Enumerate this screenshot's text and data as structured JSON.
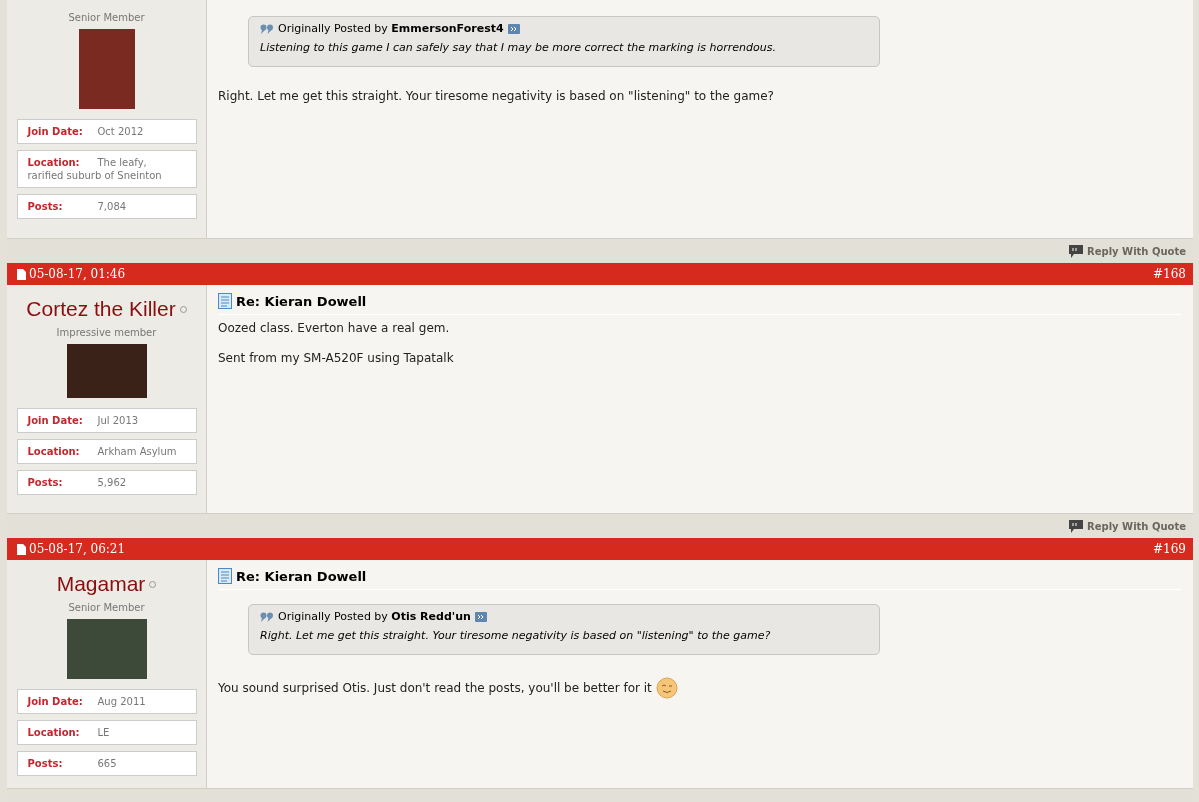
{
  "posts": [
    {
      "rank": "Senior Member",
      "info": [
        {
          "label": "Join Date:",
          "value": "Oct 2012"
        },
        {
          "label": "Location:",
          "value": "The leafy, rarified suburb of Sneinton"
        },
        {
          "label": "Posts:",
          "value": "7,084"
        }
      ],
      "quote": {
        "prefix": "Originally Posted by",
        "author": "EmmersonForest4",
        "text": "Listening to this game I can safely say that I may be more correct the marking is horrendous."
      },
      "message": [
        {
          "text": "Right. Let me get this straight. Your tiresome negativity is based on \"listening\" to the game?",
          "smiley": false
        }
      ],
      "reply": "Reply With Quote"
    },
    {
      "date": "05-08-17, 01:46",
      "number": "#168",
      "user": {
        "name": "Cortez the Killer",
        "online": false
      },
      "rank": "Impressive member",
      "info": [
        {
          "label": "Join Date:",
          "value": "Jul 2013"
        },
        {
          "label": "Location:",
          "value": "Arkham Asylum"
        },
        {
          "label": "Posts:",
          "value": "5,962"
        }
      ],
      "title": "Re: Kieran Dowell",
      "message": [
        {
          "text": "Oozed class. Everton have a real gem.",
          "smiley": false
        },
        {
          "text": "Sent from my SM-A520F using Tapatalk",
          "smiley": false
        }
      ],
      "reply": "Reply With Quote"
    },
    {
      "date": "05-08-17, 06:21",
      "number": "#169",
      "user": {
        "name": "Magamar",
        "online": false
      },
      "rank": "Senior Member",
      "info": [
        {
          "label": "Join Date:",
          "value": "Aug 2011"
        },
        {
          "label": "Location:",
          "value": "LE"
        },
        {
          "label": "Posts:",
          "value": "665"
        }
      ],
      "title": "Re: Kieran Dowell",
      "quote": {
        "prefix": "Originally Posted by",
        "author": "Otis Redd'un",
        "text": "Right. Let me get this straight. Your tiresome negativity is based on \"listening\" to the game?"
      },
      "message": [
        {
          "text": "You sound surprised Otis. Just don't read the posts, you'll be better for it",
          "smiley": true
        }
      ]
    }
  ]
}
